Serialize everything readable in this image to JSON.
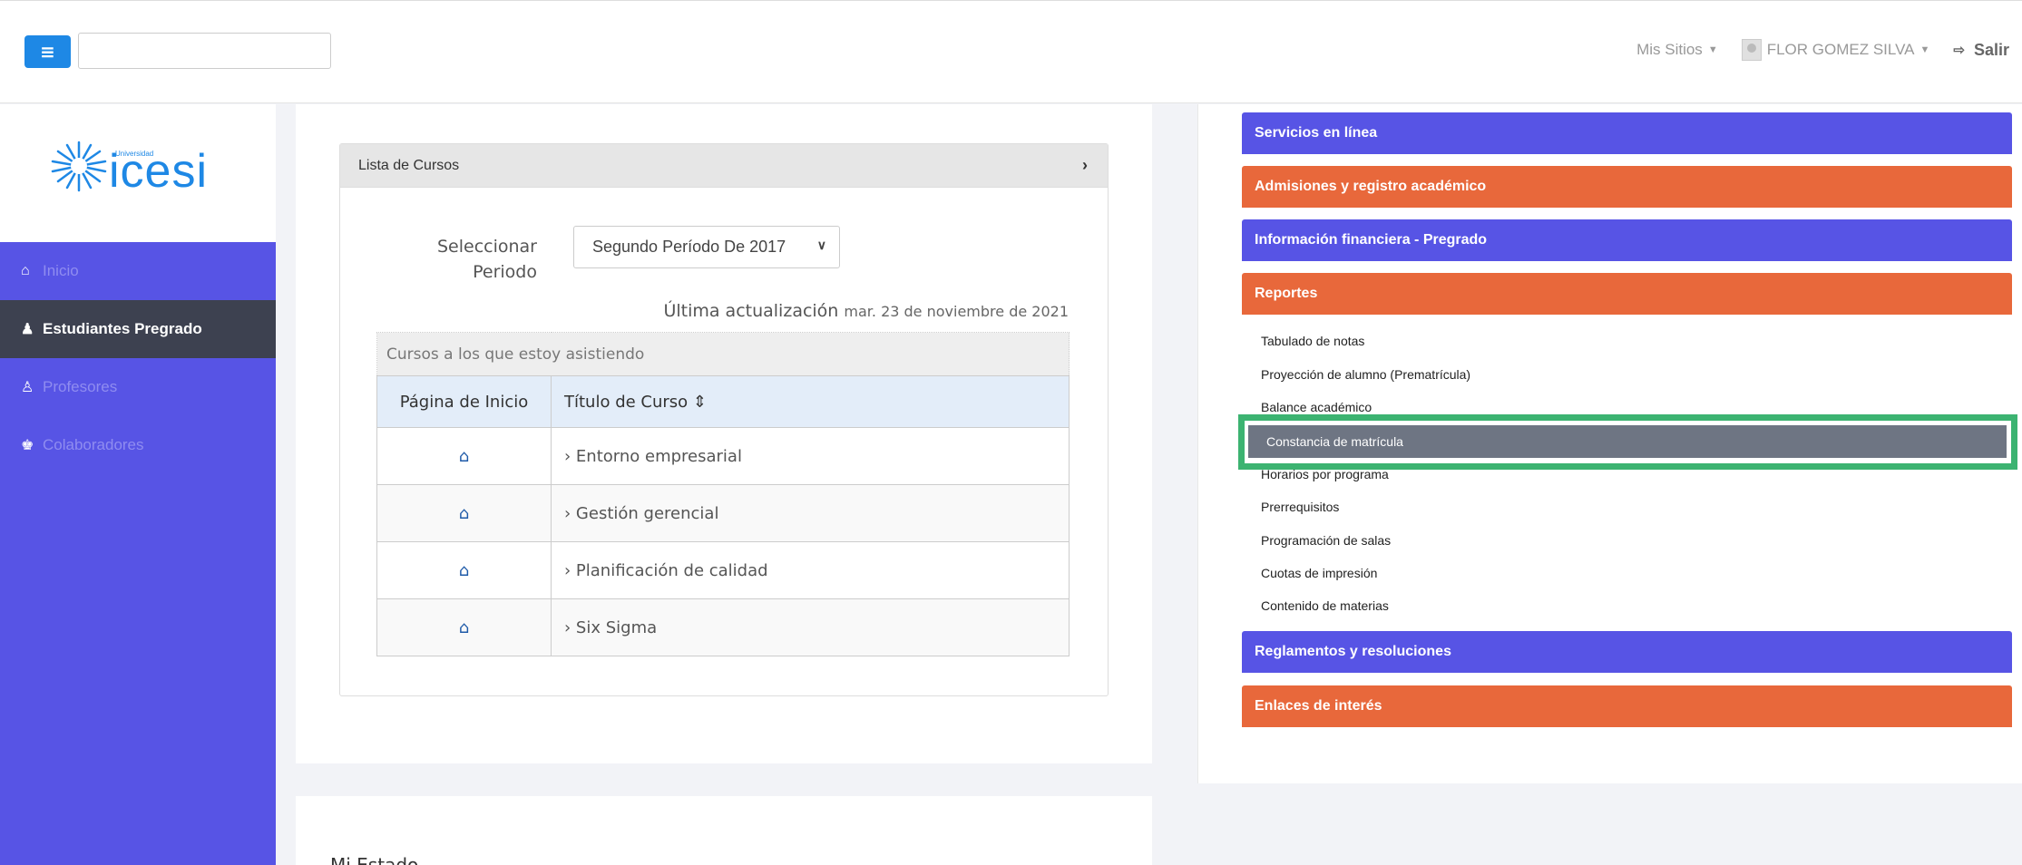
{
  "header": {
    "menu_icon": "bars-icon",
    "search": {
      "value": "",
      "placeholder": ""
    },
    "mis_sitios": "Mis Sitios",
    "user_name": "FLOR GOMEZ SILVA",
    "salir": "Salir"
  },
  "sidebar": {
    "logo": {
      "small": "Universidad",
      "name": "icesi"
    },
    "items": [
      {
        "label": "Inicio",
        "icon": "home-icon"
      },
      {
        "label": "Estudiantes Pregrado",
        "icon": "student-icon"
      },
      {
        "label": "Profesores",
        "icon": "teacher-icon"
      },
      {
        "label": "Colaboradores",
        "icon": "collaborators-icon"
      }
    ]
  },
  "courses_panel": {
    "title": "Lista de Cursos",
    "periodo_label_1": "Seleccionar",
    "periodo_label_2": "Periodo",
    "periodo_value": "Segundo Período De 2017",
    "ultima_label": "Última actualización",
    "ultima_date": "mar. 23 de noviembre de 2021",
    "table_caption": "Cursos a los que estoy asistiendo",
    "col_home": "Página de Inicio",
    "col_title": "Título de Curso",
    "courses": [
      "Entorno empresarial",
      "Gestión gerencial",
      "Planificación de calidad",
      "Six Sigma"
    ]
  },
  "bottom_panel": {
    "text": "Mi Estado"
  },
  "right_panel": {
    "servicios": "Servicios en línea",
    "admisiones": "Admisiones y registro académico",
    "financiera": "Información financiera - Pregrado",
    "reportes": "Reportes",
    "reportes_items": [
      "Tabulado de notas",
      "Proyección de alumno (Prematrícula)",
      "Balance académico",
      "Constancia de matrícula",
      "Horarios por programa",
      "Prerrequisitos",
      "Programación de salas",
      "Cuotas de impresión",
      "Contenido de materias"
    ],
    "reglamentos": "Reglamentos y resoluciones",
    "enlaces": "Enlaces de interés"
  },
  "colors": {
    "blue": "#5754e5",
    "orange": "#e8683b",
    "dark": "#3d4150",
    "highlight": "#3cb371"
  }
}
